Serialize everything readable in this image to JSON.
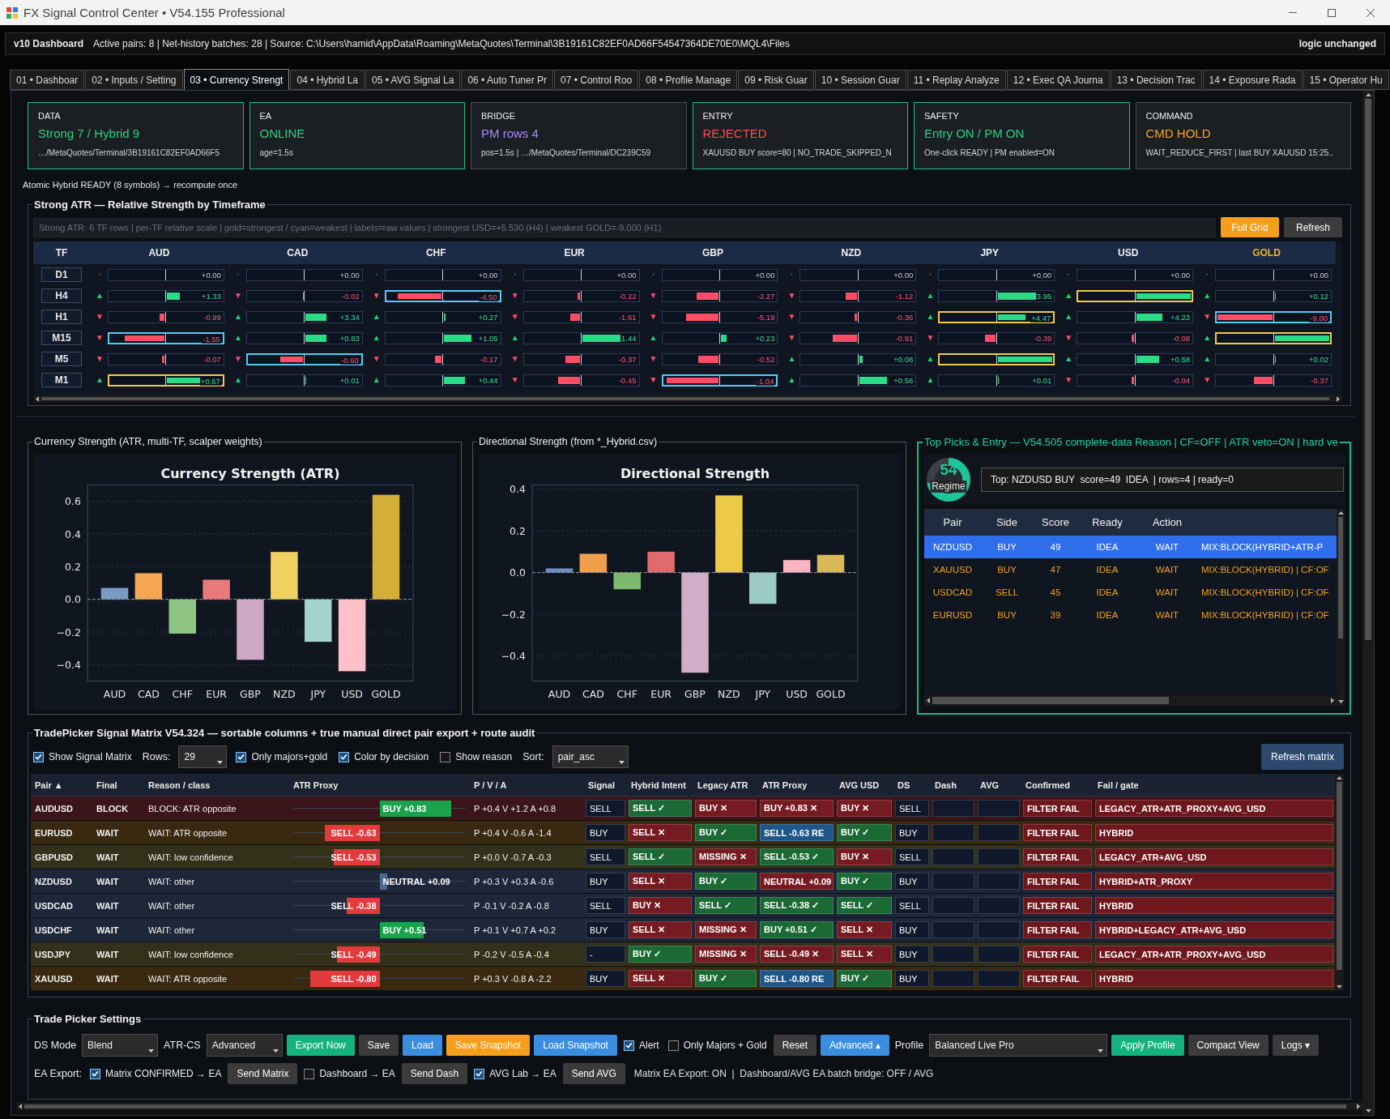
{
  "window": {
    "title": "FX Signal Control Center • V54.155 Professional"
  },
  "header": {
    "title": "v10 Dashboard",
    "info": "Active pairs: 8 | Net-history batches: 28 | Source: C:\\Users\\hamid\\AppData\\Roaming\\MetaQuotes\\Terminal\\3B19161C82EF0AD66F54547364DE70E0\\MQL4\\Files",
    "status": "logic unchanged"
  },
  "tabs": [
    {
      "label": "01 • Dashboar",
      "selected": false
    },
    {
      "label": "02 • Inputs / Setting",
      "selected": false
    },
    {
      "label": "03 • Currency Strengt",
      "selected": true
    },
    {
      "label": "04 • Hybrid La",
      "selected": false
    },
    {
      "label": "05 • AVG Signal La",
      "selected": false
    },
    {
      "label": "06 • Auto Tuner Pr",
      "selected": false
    },
    {
      "label": "07 • Control Roo",
      "selected": false
    },
    {
      "label": "08 • Profile Manage",
      "selected": false
    },
    {
      "label": "09 • Risk Guar",
      "selected": false
    },
    {
      "label": "10 • Session Guar",
      "selected": false
    },
    {
      "label": "11 • Replay Analyze",
      "selected": false
    },
    {
      "label": "12 • Exec QA Journa",
      "selected": false
    },
    {
      "label": "13 • Decision Trac",
      "selected": false
    },
    {
      "label": "14 • Exposure Rada",
      "selected": false
    },
    {
      "label": "15 • Operator Hu",
      "selected": false
    }
  ],
  "cards": [
    {
      "label": "DATA",
      "value": "Strong 7 / Hybrid 9",
      "detail": "…/MetaQuotes/Terminal/3B19161C82EF0AD66F5",
      "color": "#2bd27f",
      "highlighted": true
    },
    {
      "label": "EA",
      "value": "ONLINE",
      "detail": "age=1.5s",
      "color": "#2bd27f",
      "highlighted": true
    },
    {
      "label": "BRIDGE",
      "value": "PM rows 4",
      "detail": "pos=1.5s | …/MetaQuotes/Terminal/DC239C59",
      "color": "#a98bfa",
      "highlighted": false
    },
    {
      "label": "ENTRY",
      "value": "REJECTED",
      "detail": "XAUUSD BUY score=80 | NO_TRADE_SKIPPED_N",
      "color": "#ff4d4f",
      "highlighted": true
    },
    {
      "label": "SAFETY",
      "value": "Entry ON / PM ON",
      "detail": "One-click READY | PM enabled=ON",
      "color": "#2bd27f",
      "highlighted": true
    },
    {
      "label": "COMMAND",
      "value": "CMD HOLD",
      "detail": "WAIT_REDUCE_FIRST | last BUY XAUUSD 15:25..",
      "color": "#f5a623",
      "highlighted": false
    }
  ],
  "status_line": "Atomic Hybrid READY (8 symbols) → recompute once",
  "strong_atr": {
    "title": "Strong ATR — Relative Strength by Timeframe",
    "info": "Strong ATR: 6 TF rows | per-TF relative scale | gold=strongest / cyan=weakest | labels=raw values | strongest USD=+5.530 (H4) | weakest GOLD=-9.000 (H1)",
    "buttons": [
      {
        "label": "Full Grid",
        "color": "#f59e1b"
      },
      {
        "label": "Refresh",
        "color": "#3b3b3b"
      }
    ],
    "tf_header": "TF",
    "columns": [
      {
        "label": "AUD",
        "highlighted": false
      },
      {
        "label": "CAD",
        "highlighted": false
      },
      {
        "label": "CHF",
        "highlighted": false
      },
      {
        "label": "EUR",
        "highlighted": false
      },
      {
        "label": "GBP",
        "highlighted": false
      },
      {
        "label": "NZD",
        "highlighted": false
      },
      {
        "label": "JPY",
        "highlighted": false
      },
      {
        "label": "USD",
        "highlighted": false
      },
      {
        "label": "GOLD",
        "highlighted": true
      }
    ],
    "rows": [
      {
        "tf": "D1",
        "cells": [
          {
            "arrow": {
              "text": "·"
            },
            "value": "+0.00"
          },
          {
            "arrow": {
              "text": "·"
            },
            "value": "+0.00"
          },
          {
            "arrow": {
              "text": "·"
            },
            "value": "+0.00"
          },
          {
            "arrow": {
              "text": "·"
            },
            "value": "+0.00"
          },
          {
            "arrow": {
              "text": "·"
            },
            "value": "+0.00"
          },
          {
            "arrow": {
              "text": "·"
            },
            "value": "+0.00"
          },
          {
            "arrow": {
              "text": "·"
            },
            "value": "+0.00"
          },
          {
            "arrow": {
              "text": "·"
            },
            "value": "+0.00"
          },
          {
            "arrow": {
              "text": "·"
            },
            "value": "+0.00"
          }
        ]
      },
      {
        "tf": "H4",
        "cells": [
          {
            "arrow": {
              "text": "▲",
              "color": "#22d07a"
            },
            "negative": false,
            "level": 0.23,
            "value": "+1.33"
          },
          {
            "arrow": {
              "text": "▼",
              "color": "#ff4d66"
            },
            "negative": true,
            "level": 0.01,
            "value": "-0.02"
          },
          {
            "arrow": {
              "text": "▼",
              "color": "#ff4d66"
            },
            "negative": true,
            "level": 0.8,
            "value": "-4.50",
            "weakest": true
          },
          {
            "arrow": {
              "text": "▼",
              "color": "#ff4d66"
            },
            "negative": true,
            "level": 0.04,
            "value": "-0.22"
          },
          {
            "arrow": {
              "text": "▼",
              "color": "#ff4d66"
            },
            "negative": true,
            "level": 0.4,
            "value": "-2.27"
          },
          {
            "arrow": {
              "text": "▼",
              "color": "#ff4d66"
            },
            "negative": true,
            "level": 0.2,
            "value": "-1.12"
          },
          {
            "arrow": {
              "text": "▲",
              "color": "#22d07a"
            },
            "negative": false,
            "level": 0.7,
            "value": "3.95"
          },
          {
            "arrow": {
              "text": "▲",
              "color": "#22d07a"
            },
            "negative": false,
            "level": 1,
            "strongest": true
          },
          {
            "arrow": {
              "text": "▲",
              "color": "#22d07a"
            },
            "negative": false,
            "level": 0.02,
            "value": "+0.12"
          }
        ]
      },
      {
        "tf": "H1",
        "cells": [
          {
            "arrow": {
              "text": "▼",
              "color": "#ff4d66"
            },
            "negative": true,
            "level": 0.1,
            "value": "-0.99"
          },
          {
            "arrow": {
              "text": "▲",
              "color": "#22d07a"
            },
            "negative": false,
            "level": 0.37,
            "value": "+3.34"
          },
          {
            "arrow": {
              "text": "▲",
              "color": "#22d07a"
            },
            "negative": false,
            "level": 0.03,
            "value": "+0.27"
          },
          {
            "arrow": {
              "text": "▼",
              "color": "#ff4d66"
            },
            "negative": true,
            "level": 0.18,
            "value": "-1.61"
          },
          {
            "arrow": {
              "text": "▼",
              "color": "#ff4d66"
            },
            "negative": true,
            "level": 0.58,
            "value": "-5.19"
          },
          {
            "arrow": {
              "text": "▼",
              "color": "#ff4d66"
            },
            "negative": true,
            "level": 0.04,
            "value": "-0.36"
          },
          {
            "arrow": {
              "text": "▲",
              "color": "#22d07a"
            },
            "negative": false,
            "level": 0.5,
            "value": "+4.47",
            "strongest": true
          },
          {
            "arrow": {
              "text": "▲",
              "color": "#22d07a"
            },
            "negative": false,
            "level": 0.47,
            "value": "+4.23"
          },
          {
            "arrow": {
              "text": "▼",
              "color": "#ff4d66"
            },
            "negative": true,
            "level": 1,
            "value": "-9.00",
            "weakest": true
          }
        ]
      },
      {
        "tf": "M15",
        "cells": [
          {
            "arrow": {
              "text": "▼",
              "color": "#ff4d66"
            },
            "negative": true,
            "level": 0.74,
            "value": "-1.55",
            "weakest": true
          },
          {
            "arrow": {
              "text": "▲",
              "color": "#22d07a"
            },
            "negative": false,
            "level": 0.38,
            "value": "+0.83"
          },
          {
            "arrow": {
              "text": "▲",
              "color": "#22d07a"
            },
            "negative": false,
            "level": 0.5,
            "value": "+1.05"
          },
          {
            "arrow": {
              "text": "▲",
              "color": "#22d07a"
            },
            "negative": false,
            "level": 0.68,
            "value": "1.44"
          },
          {
            "arrow": {
              "text": "▲",
              "color": "#22d07a"
            },
            "negative": false,
            "level": 0.1,
            "value": "+0.23"
          },
          {
            "arrow": {
              "text": "▼",
              "color": "#ff4d66"
            },
            "negative": true,
            "level": 0.43,
            "value": "-0.91"
          },
          {
            "arrow": {
              "text": "▼",
              "color": "#ff4d66"
            },
            "negative": true,
            "level": 0.18,
            "value": "-0.39"
          },
          {
            "arrow": {
              "text": "▼",
              "color": "#ff4d66"
            },
            "negative": true,
            "level": 0.04,
            "value": "-0.08"
          },
          {
            "arrow": {
              "text": "▲",
              "color": "#22d07a"
            },
            "negative": false,
            "level": 1,
            "strongest": true
          }
        ]
      },
      {
        "tf": "M5",
        "cells": [
          {
            "arrow": {
              "text": "▼",
              "color": "#ff4d66"
            },
            "negative": true,
            "level": 0.05,
            "value": "-0.07"
          },
          {
            "arrow": {
              "text": "▼",
              "color": "#ff4d66"
            },
            "negative": true,
            "level": 0.42,
            "value": "-0.60",
            "weakest": true
          },
          {
            "arrow": {
              "text": "▼",
              "color": "#ff4d66"
            },
            "negative": true,
            "level": 0.12,
            "value": "-0.17"
          },
          {
            "arrow": {
              "text": "▼",
              "color": "#ff4d66"
            },
            "negative": true,
            "level": 0.27,
            "value": "-0.37"
          },
          {
            "arrow": {
              "text": "▼",
              "color": "#ff4d66"
            },
            "negative": true,
            "level": 0.36,
            "value": "-0.52"
          },
          {
            "arrow": {
              "text": "▲",
              "color": "#22d07a"
            },
            "negative": false,
            "level": 0.06,
            "value": "+0.08"
          },
          {
            "arrow": {
              "text": "▲",
              "color": "#22d07a"
            },
            "negative": false,
            "level": 1,
            "strongest": true
          },
          {
            "arrow": {
              "text": "▲",
              "color": "#22d07a"
            },
            "negative": false,
            "level": 0.41,
            "value": "+0.58"
          },
          {
            "arrow": {
              "text": "▲",
              "color": "#22d07a"
            },
            "negative": false,
            "level": 0.02,
            "value": "+0.02"
          }
        ]
      },
      {
        "tf": "M1",
        "cells": [
          {
            "arrow": {
              "text": "▲",
              "color": "#22d07a"
            },
            "negative": false,
            "level": 0.6,
            "value": "+0.67",
            "strongest": true
          },
          {
            "arrow": {
              "text": "▲",
              "color": "#22d07a"
            },
            "negative": false,
            "level": 0.01,
            "value": "+0.01"
          },
          {
            "arrow": {
              "text": "▲",
              "color": "#22d07a"
            },
            "negative": false,
            "level": 0.38,
            "value": "+0.44"
          },
          {
            "arrow": {
              "text": "▼",
              "color": "#ff4d66"
            },
            "negative": true,
            "level": 0.39,
            "value": "-0.45"
          },
          {
            "arrow": {
              "text": "▼",
              "color": "#ff4d66"
            },
            "negative": true,
            "level": 0.95,
            "value": "-1.04",
            "weakest": true
          },
          {
            "arrow": {
              "text": "▲",
              "color": "#22d07a"
            },
            "negative": false,
            "level": 0.5,
            "value": "+0.56"
          },
          {
            "arrow": {
              "text": "▲",
              "color": "#22d07a"
            },
            "negative": false,
            "level": 0.01,
            "value": "+0.01"
          },
          {
            "arrow": {
              "text": "▼",
              "color": "#ff4d66"
            },
            "negative": true,
            "level": 0.04,
            "value": "-0.04"
          },
          {
            "arrow": {
              "text": "▼",
              "color": "#ff4d66"
            },
            "negative": true,
            "level": 0.33,
            "value": "-0.37"
          }
        ]
      }
    ]
  },
  "charts": [
    {
      "title": "Currency Strength (ATR, multi-TF, scalper weights)",
      "chart_data": {
        "type": "bar",
        "title": "Currency Strength (ATR)",
        "categories": [
          "AUD",
          "CAD",
          "CHF",
          "EUR",
          "GBP",
          "NZD",
          "JPY",
          "USD",
          "GOLD"
        ],
        "values": [
          0.07,
          0.16,
          -0.21,
          0.12,
          -0.37,
          0.29,
          -0.26,
          -0.44,
          0.64
        ],
        "colors": [
          "#7b9bc4",
          "#f4a652",
          "#8dc383",
          "#e87a7a",
          "#cfa8c8",
          "#f0d060",
          "#a3d2cf",
          "#ffc0c8",
          "#d4af37"
        ],
        "ylim": [
          -0.5,
          0.7
        ],
        "yticks": [
          {
            "value": -0.4,
            "label": "−0.4"
          },
          {
            "value": -0.2,
            "label": "−0.2"
          },
          {
            "value": 0,
            "label": "0.0"
          },
          {
            "value": 0.2,
            "label": "0.2"
          },
          {
            "value": 0.4,
            "label": "0.4"
          },
          {
            "value": 0.6,
            "label": "0.6"
          }
        ],
        "grid": true,
        "ref_lines": [
          {
            "axis": "y",
            "value": 0
          }
        ]
      }
    },
    {
      "title": "Directional Strength (from *_Hybrid.csv)",
      "chart_data": {
        "type": "bar",
        "title": "Directional Strength",
        "categories": [
          "AUD",
          "CAD",
          "CHF",
          "EUR",
          "GBP",
          "NZD",
          "JPY",
          "USD",
          "GOLD"
        ],
        "values": [
          0.02,
          0.09,
          -0.08,
          0.1,
          -0.48,
          0.37,
          -0.15,
          0.06,
          0.085
        ],
        "colors": [
          "#6b8fbf",
          "#f0a04b",
          "#7fb86f",
          "#e06a6e",
          "#d1aec8",
          "#edc948",
          "#9ccac4",
          "#ffb3c0",
          "#d9b85a"
        ],
        "ylim": [
          -0.52,
          0.42
        ],
        "yticks": [
          {
            "value": -0.4,
            "label": "−0.4"
          },
          {
            "value": -0.2,
            "label": "−0.2"
          },
          {
            "value": 0,
            "label": "0.0"
          },
          {
            "value": 0.2,
            "label": "0.2"
          },
          {
            "value": 0.4,
            "label": "0.4"
          }
        ],
        "grid": true,
        "ref_lines": [
          {
            "axis": "y",
            "value": 0
          }
        ]
      }
    }
  ],
  "top_picks": {
    "title": "Top Picks & Entry — V54.505 complete-data Reason | CF=OFF | ATR veto=ON | hard ve",
    "regime": {
      "value": "54",
      "label": "Regime",
      "level": 0.72
    },
    "summary": "Top: NZDUSD BUY  score=49  IDEA  | rows=4 | ready=0",
    "columns": [
      "Pair",
      "Side",
      "Score",
      "Ready",
      "Action"
    ],
    "rows": [
      {
        "cells": [
          "NZDUSD",
          "BUY",
          "49",
          "IDEA",
          "WAIT",
          "MIX:BLOCK(HYBRID+ATR-P"
        ],
        "selected": true
      },
      {
        "cells": [
          "XAUUSD",
          "BUY",
          "47",
          "IDEA",
          "WAIT",
          "MIX:BLOCK(HYBRID) | CF:OF"
        ],
        "selected": false
      },
      {
        "cells": [
          "USDCAD",
          "SELL",
          "45",
          "IDEA",
          "WAIT",
          "MIX:BLOCK(HYBRID) | CF:OF"
        ],
        "selected": false
      },
      {
        "cells": [
          "EURUSD",
          "BUY",
          "39",
          "IDEA",
          "WAIT",
          "MIX:BLOCK(HYBRID) | CF:OF"
        ],
        "selected": false
      }
    ]
  },
  "matrix": {
    "title": "TradePicker Signal Matrix V54.324 — sortable columns + true manual direct pair export + route audit",
    "controls": [
      {
        "kind": "checkbox",
        "label": "Show Signal Matrix",
        "checked": true
      },
      {
        "kind": "label",
        "text": "Rows:"
      },
      {
        "kind": "select",
        "value": "29"
      },
      {
        "kind": "checkbox",
        "label": "Only majors+gold",
        "checked": true
      },
      {
        "kind": "checkbox",
        "label": "Color by decision",
        "checked": true
      },
      {
        "kind": "checkbox",
        "label": "Show reason",
        "checked": false
      },
      {
        "kind": "label",
        "text": "Sort:"
      },
      {
        "kind": "select",
        "value": "pair_asc"
      }
    ],
    "refresh_button": "Refresh matrix",
    "columns": [
      "Pair ▲",
      "Final",
      "Reason / class",
      "ATR Proxy",
      "P / V / A",
      "Signal",
      "Hybrid Intent",
      "Legacy ATR",
      "ATR Proxy",
      "AVG USD",
      "DS",
      "Dash",
      "AVG",
      "Confirmed",
      "Fail / gate"
    ],
    "rows": [
      {
        "pair": "AUDUSD",
        "final": "BLOCK",
        "reason": "BLOCK: ATR opposite",
        "color": "#3b1519",
        "proxy": {
          "label": "BUY +0.83",
          "color": "#1aa34a",
          "negative": false,
          "level": 0.83
        },
        "pva": "P +0.4 V +1.2 A +0.8",
        "signal": "SELL",
        "hybrid": {
          "text": "SELL ✓",
          "color": "#1b6a36"
        },
        "legacy": {
          "text": "BUY ✕",
          "color": "#761b21"
        },
        "atr": {
          "text": "BUY +0.83 ✕",
          "color": "#761b21"
        },
        "avg_usd": {
          "text": "BUY ✕",
          "color": "#761b21"
        },
        "ds": "SELL",
        "confirmed": "FILTER FAIL",
        "gate": "LEGACY_ATR+ATR_PROXY+AVG_USD"
      },
      {
        "pair": "EURUSD",
        "final": "WAIT",
        "reason": "WAIT: ATR opposite",
        "color": "#3a2911",
        "proxy": {
          "label": "SELL -0.63",
          "color": "#e23a3d",
          "negative": true,
          "level": 0.63
        },
        "pva": "P +0.4 V -0.6 A -1.4",
        "signal": "BUY",
        "hybrid": {
          "text": "SELL ✕",
          "color": "#761b21"
        },
        "legacy": {
          "text": "BUY ✓",
          "color": "#1b6a36"
        },
        "atr": {
          "text": "SELL -0.63 RE",
          "color": "#1d5688"
        },
        "avg_usd": {
          "text": "BUY ✓",
          "color": "#1b6a36"
        },
        "ds": "BUY",
        "confirmed": "FILTER FAIL",
        "gate": "HYBRID"
      },
      {
        "pair": "GBPUSD",
        "final": "WAIT",
        "reason": "WAIT: low confidence",
        "color": "#34311a",
        "proxy": {
          "label": "SELL -0.53",
          "color": "#e23a3d",
          "negative": true,
          "level": 0.53
        },
        "pva": "P +0.0 V -0.7 A -0.3",
        "signal": "SELL",
        "hybrid": {
          "text": "SELL ✓",
          "color": "#1b6a36"
        },
        "legacy": {
          "text": "MISSING ✕",
          "color": "#761b21"
        },
        "atr": {
          "text": "SELL -0.53 ✓",
          "color": "#1b6a36"
        },
        "avg_usd": {
          "text": "BUY ✕",
          "color": "#761b21"
        },
        "ds": "SELL",
        "confirmed": "FILTER FAIL",
        "gate": "LEGACY_ATR+AVG_USD"
      },
      {
        "pair": "NZDUSD",
        "final": "WAIT",
        "reason": "WAIT: other",
        "color": "#1d2739",
        "proxy": {
          "label": "NEUTRAL +0.09",
          "color": "#4f6a92",
          "negative": false,
          "level": 0.09
        },
        "pva": "P +0.3 V +0.3 A -0.6",
        "signal": "BUY",
        "hybrid": {
          "text": "SELL ✕",
          "color": "#761b21"
        },
        "legacy": {
          "text": "BUY ✓",
          "color": "#1b6a36"
        },
        "atr": {
          "text": "NEUTRAL +0.09",
          "color": "#761b21"
        },
        "avg_usd": {
          "text": "BUY ✓",
          "color": "#1b6a36"
        },
        "ds": "BUY",
        "confirmed": "FILTER FAIL",
        "gate": "HYBRID+ATR_PROXY"
      },
      {
        "pair": "USDCAD",
        "final": "WAIT",
        "reason": "WAIT: other",
        "color": "#1d2739",
        "proxy": {
          "label": "SELL -0.38",
          "color": "#e23a3d",
          "negative": true,
          "level": 0.38
        },
        "pva": "P -0.1 V -0.2 A -0.8",
        "signal": "SELL",
        "hybrid": {
          "text": "BUY ✕",
          "color": "#761b21"
        },
        "legacy": {
          "text": "SELL ✓",
          "color": "#1b6a36"
        },
        "atr": {
          "text": "SELL -0.38 ✓",
          "color": "#1b6a36"
        },
        "avg_usd": {
          "text": "SELL ✓",
          "color": "#1b6a36"
        },
        "ds": "SELL",
        "confirmed": "FILTER FAIL",
        "gate": "HYBRID"
      },
      {
        "pair": "USDCHF",
        "final": "WAIT",
        "reason": "WAIT: other",
        "color": "#1d2739",
        "proxy": {
          "label": "BUY +0.51",
          "color": "#1aa34a",
          "negative": false,
          "level": 0.51
        },
        "pva": "P +0.1 V +0.7 A +0.2",
        "signal": "BUY",
        "hybrid": {
          "text": "SELL ✕",
          "color": "#761b21"
        },
        "legacy": {
          "text": "MISSING ✕",
          "color": "#761b21"
        },
        "atr": {
          "text": "BUY +0.51 ✓",
          "color": "#1b6a36"
        },
        "avg_usd": {
          "text": "SELL ✕",
          "color": "#761b21"
        },
        "ds": "BUY",
        "confirmed": "FILTER FAIL",
        "gate": "HYBRID+LEGACY_ATR+AVG_USD"
      },
      {
        "pair": "USDJPY",
        "final": "WAIT",
        "reason": "WAIT: low confidence",
        "color": "#34311a",
        "proxy": {
          "label": "SELL -0.49",
          "color": "#e23a3d",
          "negative": true,
          "level": 0.49
        },
        "pva": "P -0.2 V -0.5 A -0.4",
        "signal": "-",
        "hybrid": {
          "text": "BUY ✓",
          "color": "#1b6a36"
        },
        "legacy": {
          "text": "MISSING ✕",
          "color": "#761b21"
        },
        "atr": {
          "text": "SELL -0.49 ✕",
          "color": "#761b21"
        },
        "avg_usd": {
          "text": "SELL ✕",
          "color": "#761b21"
        },
        "ds": "BUY",
        "confirmed": "FILTER FAIL",
        "gate": "LEGACY_ATR+ATR_PROXY+AVG_USD"
      },
      {
        "pair": "XAUUSD",
        "final": "WAIT",
        "reason": "WAIT: ATR opposite",
        "color": "#3a2911",
        "proxy": {
          "label": "SELL -0.80",
          "color": "#e23a3d",
          "negative": true,
          "level": 0.8
        },
        "pva": "P +0.3 V -0.8 A -2.2",
        "signal": "BUY",
        "hybrid": {
          "text": "SELL ✕",
          "color": "#761b21"
        },
        "legacy": {
          "text": "BUY ✓",
          "color": "#1b6a36"
        },
        "atr": {
          "text": "SELL -0.80 RE",
          "color": "#1d5688"
        },
        "avg_usd": {
          "text": "BUY ✓",
          "color": "#1b6a36"
        },
        "ds": "BUY",
        "confirmed": "FILTER FAIL",
        "gate": "HYBRID"
      }
    ]
  },
  "settings": {
    "title": "Trade Picker Settings",
    "rows": [
      {
        "items": [
          {
            "kind": "label",
            "text": "DS Mode"
          },
          {
            "kind": "select",
            "value": "Blend"
          },
          {
            "kind": "label",
            "text": "ATR-CS"
          },
          {
            "kind": "select",
            "value": "Advanced"
          },
          {
            "kind": "button",
            "label": "Export Now",
            "color": "#14b27f"
          },
          {
            "kind": "button",
            "label": "Save",
            "color": "#3b3b3b"
          },
          {
            "kind": "button",
            "label": "Load",
            "color": "#3a8ee0"
          },
          {
            "kind": "button",
            "label": "Save Snapshot",
            "color": "#f59e1b"
          },
          {
            "kind": "button",
            "label": "Load Snapshot",
            "color": "#3a8ee0"
          },
          {
            "kind": "checkbox",
            "label": "Alert",
            "checked": true
          },
          {
            "kind": "checkbox",
            "label": "Only Majors + Gold",
            "checked": false
          },
          {
            "kind": "button",
            "label": "Reset",
            "color": "#3b3b3b"
          },
          {
            "kind": "button",
            "label": "Advanced ▴",
            "color": "#3a8ee0"
          },
          {
            "kind": "label",
            "text": "Profile"
          },
          {
            "kind": "select",
            "value": "Balanced Live Pro"
          },
          {
            "kind": "button",
            "label": "Apply Profile",
            "color": "#14b27f"
          },
          {
            "kind": "button",
            "label": "Compact View",
            "color": "#3b3b3b"
          },
          {
            "kind": "button",
            "label": "Logs ▾",
            "color": "#3b3b3b"
          }
        ]
      },
      {
        "items": [
          {
            "kind": "label",
            "text": "EA Export:"
          },
          {
            "kind": "checkbox",
            "label": "Matrix CONFIRMED → EA",
            "checked": true
          },
          {
            "kind": "button",
            "label": "Send Matrix",
            "color": "#3b3b3b"
          },
          {
            "kind": "checkbox",
            "label": "Dashboard → EA",
            "checked": false
          },
          {
            "kind": "button",
            "label": "Send Dash",
            "color": "#3b3b3b"
          },
          {
            "kind": "checkbox",
            "label": "AVG Lab → EA",
            "checked": true
          },
          {
            "kind": "button",
            "label": "Send AVG",
            "color": "#3b3b3b"
          },
          {
            "kind": "text",
            "text": "Matrix EA Export: ON  |  Dashboard/AVG EA batch bridge: OFF / AVG"
          }
        ]
      }
    ]
  }
}
